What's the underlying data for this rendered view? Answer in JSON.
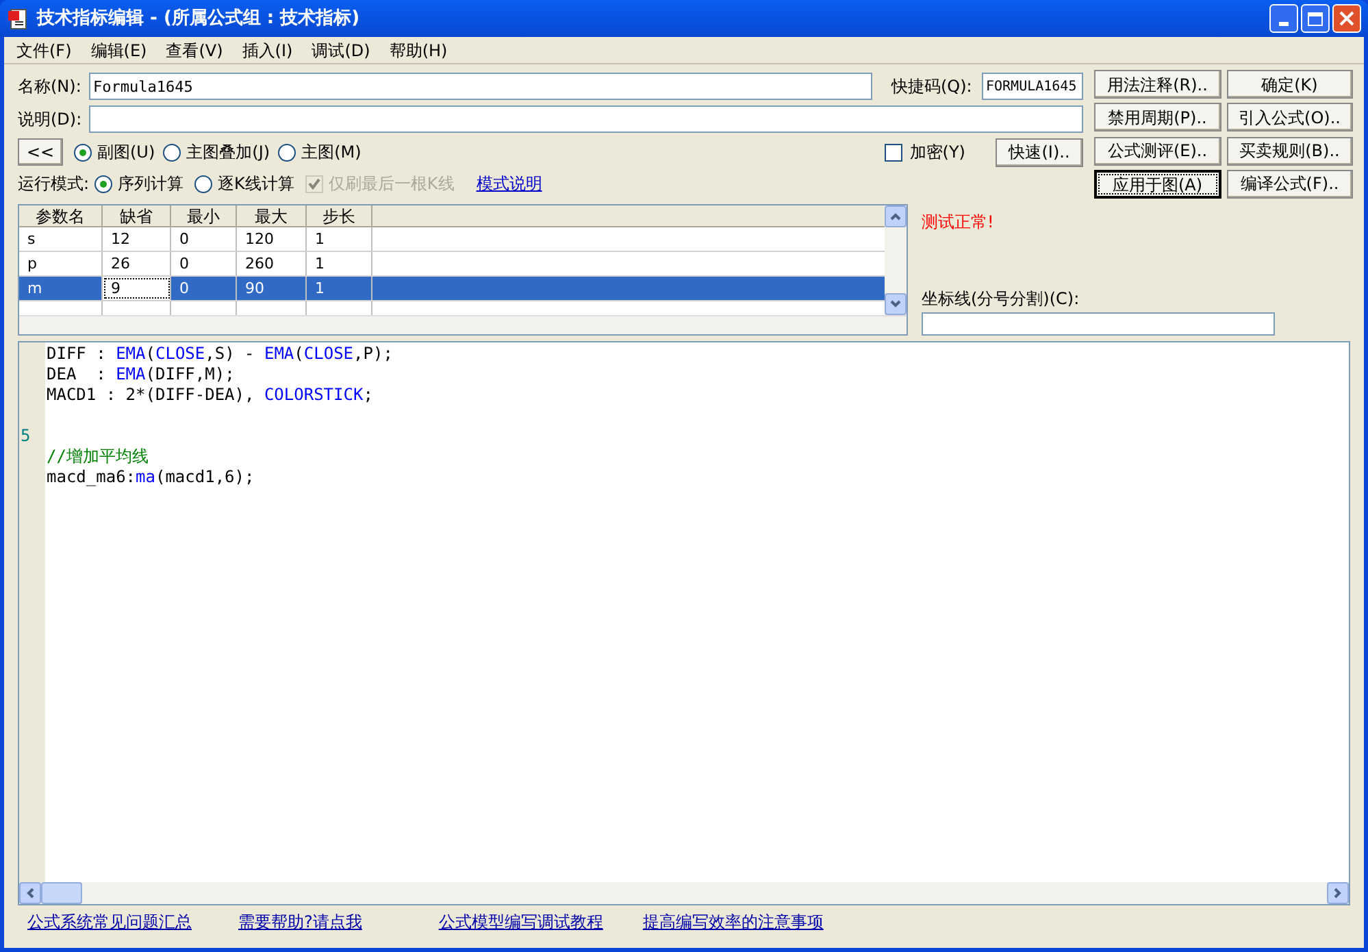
{
  "window": {
    "title": "技术指标编辑 - (所属公式组 : 技术指标)"
  },
  "menu": [
    "文件(F)",
    "编辑(E)",
    "查看(V)",
    "插入(I)",
    "调试(D)",
    "帮助(H)"
  ],
  "name_field": {
    "label": "名称(N):",
    "value": "Formula1645"
  },
  "shortcut_field": {
    "label": "快捷码(Q):",
    "value": "FORMULA1645"
  },
  "description_field": {
    "label": "说明(D):"
  },
  "collapse_button": "<<",
  "chart_type": [
    {
      "label": "副图(U)",
      "selected": true
    },
    {
      "label": "主图叠加(J)",
      "selected": false
    },
    {
      "label": "主图(M)",
      "selected": false
    }
  ],
  "encrypt": {
    "label": "加密(Y)",
    "checked": false
  },
  "quick_button": "快速(I)..",
  "run_mode": {
    "label": "运行模式:",
    "options": [
      {
        "label": "序列计算",
        "selected": true
      },
      {
        "label": "逐K线计算",
        "selected": false
      }
    ],
    "refresh_last": {
      "label": "仅刷最后一根K线",
      "checked": true,
      "disabled": true
    },
    "link": "模式说明"
  },
  "buttons": [
    {
      "label": "用法注释(R)..",
      "default": false
    },
    {
      "label": "确定(K)",
      "default": false
    },
    {
      "label": "禁用周期(P)..",
      "default": false
    },
    {
      "label": "引入公式(O)..",
      "default": false
    },
    {
      "label": "公式测评(E)..",
      "default": false
    },
    {
      "label": "买卖规则(B)..",
      "default": false
    },
    {
      "label": "应用于图(A)",
      "default": true
    },
    {
      "label": "编译公式(F)..",
      "default": false
    }
  ],
  "params": {
    "columns": [
      "参数名",
      "缺省",
      "最小",
      "最大",
      "步长"
    ],
    "rows": [
      {
        "selected": false,
        "cells": [
          {
            "text": "s",
            "focused": false
          },
          {
            "text": "12",
            "focused": false
          },
          {
            "text": "0",
            "focused": false
          },
          {
            "text": "120",
            "focused": false
          },
          {
            "text": "1",
            "focused": false
          }
        ]
      },
      {
        "selected": false,
        "cells": [
          {
            "text": "p",
            "focused": false
          },
          {
            "text": "26",
            "focused": false
          },
          {
            "text": "0",
            "focused": false
          },
          {
            "text": "260",
            "focused": false
          },
          {
            "text": "1",
            "focused": false
          }
        ]
      },
      {
        "selected": true,
        "cells": [
          {
            "text": "m",
            "focused": false
          },
          {
            "text": "9",
            "focused": true
          },
          {
            "text": "0",
            "focused": false
          },
          {
            "text": "90",
            "focused": false
          },
          {
            "text": "1",
            "focused": false
          }
        ]
      }
    ]
  },
  "status": "测试正常!",
  "axis_field": {
    "label": "坐标线(分号分割)(C):"
  },
  "code_lines": [
    {
      "kind": "code",
      "segments": [
        {
          "text": "DIFF : ",
          "kind": "plain"
        },
        {
          "text": "EMA",
          "kind": "keyword"
        },
        {
          "text": "(",
          "kind": "plain"
        },
        {
          "text": "CLOSE",
          "kind": "keyword"
        },
        {
          "text": ",S) - ",
          "kind": "plain"
        },
        {
          "text": "EMA",
          "kind": "keyword"
        },
        {
          "text": "(",
          "kind": "plain"
        },
        {
          "text": "CLOSE",
          "kind": "keyword"
        },
        {
          "text": ",P);",
          "kind": "plain"
        }
      ]
    },
    {
      "kind": "code",
      "segments": [
        {
          "text": "DEA  : ",
          "kind": "plain"
        },
        {
          "text": "EMA",
          "kind": "keyword"
        },
        {
          "text": "(DIFF,M);",
          "kind": "plain"
        }
      ]
    },
    {
      "kind": "code",
      "segments": [
        {
          "text": "MACD1 : 2*(DIFF-DEA), ",
          "kind": "plain"
        },
        {
          "text": "COLORSTICK",
          "kind": "keyword"
        },
        {
          "text": ";",
          "kind": "plain"
        }
      ]
    },
    {
      "kind": "blank"
    },
    {
      "kind": "blank",
      "marker": "5"
    },
    {
      "kind": "code",
      "segments": [
        {
          "text": "//增加平均线",
          "kind": "comment"
        }
      ]
    },
    {
      "kind": "code",
      "segments": [
        {
          "text": "macd_ma6:",
          "kind": "plain"
        },
        {
          "text": "ma",
          "kind": "keyword"
        },
        {
          "text": "(macd1,6);",
          "kind": "plain"
        }
      ]
    }
  ],
  "footer_links": [
    "公式系统常见问题汇总",
    "需要帮助?请点我",
    "公式模型编写调试教程",
    "提高编写效率的注意事项"
  ]
}
